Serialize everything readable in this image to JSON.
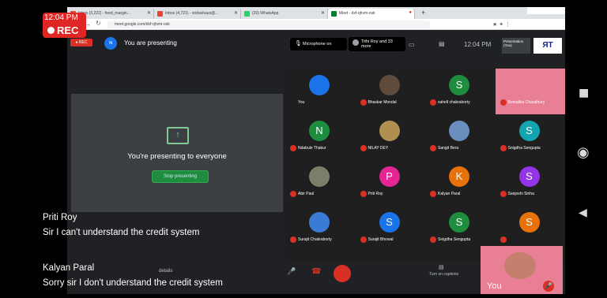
{
  "recording": {
    "time": "12:04 PM",
    "label": "REC"
  },
  "browser": {
    "tabs": [
      "Inbox (3,222) - feed_margin...",
      "Inbox (4,721) - sridavhaus@...",
      "(20) WhatsApp",
      "Meet - dxf-qhvm-osk"
    ],
    "url": "meet.google.com/dxf-qhvm-osk"
  },
  "meet": {
    "presenting_banner": "You are presenting",
    "microphone_label": "Microphone on",
    "people_label": "Tithi Roy and 33 more",
    "clock": "12:04 PM",
    "presentation_chip": "Presentation (You)",
    "presenting_message": "You're presenting to everyone",
    "stop_button": "Stop presenting",
    "details_label": "details",
    "captions_label": "Turn on captions",
    "self_label": "You"
  },
  "participants": [
    {
      "name": "You",
      "initial": "",
      "color": "#1a73e8"
    },
    {
      "name": "Bhaskar Mondal",
      "initial": "",
      "color": "#5f4b3a"
    },
    {
      "name": "sahell chakraborty",
      "initial": "S",
      "color": "#1e8e3e"
    },
    {
      "name": "Bornalika Chaudhury",
      "initial": "",
      "color": "#e87f95"
    },
    {
      "name": "Ndabule Thakur",
      "initial": "N",
      "color": "#1e8e3e"
    },
    {
      "name": "NILAY DEY",
      "initial": "",
      "color": "#b09050"
    },
    {
      "name": "Sangit Bera",
      "initial": "",
      "color": "#6a8fbf"
    },
    {
      "name": "Snigdha Sengupta",
      "initial": "S",
      "color": "#12a4af"
    },
    {
      "name": "Abir Paul",
      "initial": "",
      "color": "#7b7f6a"
    },
    {
      "name": "Priti Roy",
      "initial": "P",
      "color": "#e52592"
    },
    {
      "name": "Kalyan Paral",
      "initial": "K",
      "color": "#e8710a"
    },
    {
      "name": "Sanjoshi Sinha",
      "initial": "S",
      "color": "#9334e6"
    },
    {
      "name": "Surajit Chakraborty",
      "initial": "",
      "color": "#3a7bd5"
    },
    {
      "name": "Surajit Bhowal",
      "initial": "S",
      "color": "#1a73e8"
    },
    {
      "name": "Snigdha Sengupta",
      "initial": "S",
      "color": "#1e8e3e"
    },
    {
      "name": "",
      "initial": "S",
      "color": "#e8710a"
    }
  ],
  "captions": [
    {
      "speaker": "Priti Roy",
      "text": "Sir I can't understand the credit system"
    },
    {
      "speaker": "Kalyan Paral",
      "text": "Sorry sir I don't understand the credit system"
    }
  ]
}
